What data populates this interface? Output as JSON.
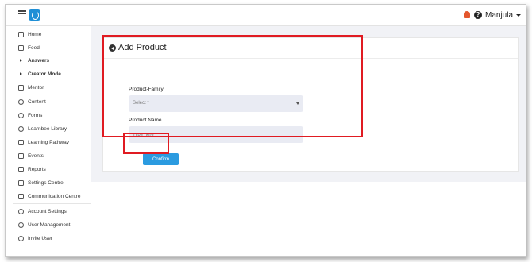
{
  "header": {
    "user_name": "Manjula",
    "help_glyph": "?"
  },
  "sidebar": {
    "items": [
      {
        "label": "Home",
        "icon": "home-icon"
      },
      {
        "label": "Feed",
        "icon": "feed-icon"
      },
      {
        "label": "Answers",
        "icon": "caret-right-icon"
      },
      {
        "label": "Creator Mode",
        "icon": "caret-right-icon"
      },
      {
        "label": "Mentor",
        "icon": "mentor-icon"
      },
      {
        "label": "Content",
        "icon": "content-icon"
      },
      {
        "label": "Forms",
        "icon": "forms-icon"
      },
      {
        "label": "Learnbee Library",
        "icon": "library-icon"
      },
      {
        "label": "Learning Pathway",
        "icon": "pathway-icon"
      },
      {
        "label": "Events",
        "icon": "calendar-icon"
      },
      {
        "label": "Reports",
        "icon": "reports-icon"
      },
      {
        "label": "Settings Centre",
        "icon": "wrench-icon"
      },
      {
        "label": "Communication Centre",
        "icon": "communication-icon"
      },
      {
        "label": "Account Settings",
        "icon": "account-settings-icon"
      },
      {
        "label": "User Management",
        "icon": "user-management-icon"
      },
      {
        "label": "Invite User",
        "icon": "invite-user-icon"
      }
    ]
  },
  "form": {
    "title": "Add Product",
    "product_family_label": "Product-Family",
    "product_family_selected": "Select *",
    "product_name_label": "Product Name",
    "product_name_placeholder": "Type here",
    "confirm_label": "Confirm"
  },
  "colors": {
    "accent": "#2b9be0",
    "highlight": "#e01b22",
    "logo": "#1f8fd6",
    "notification": "#e4572e"
  }
}
